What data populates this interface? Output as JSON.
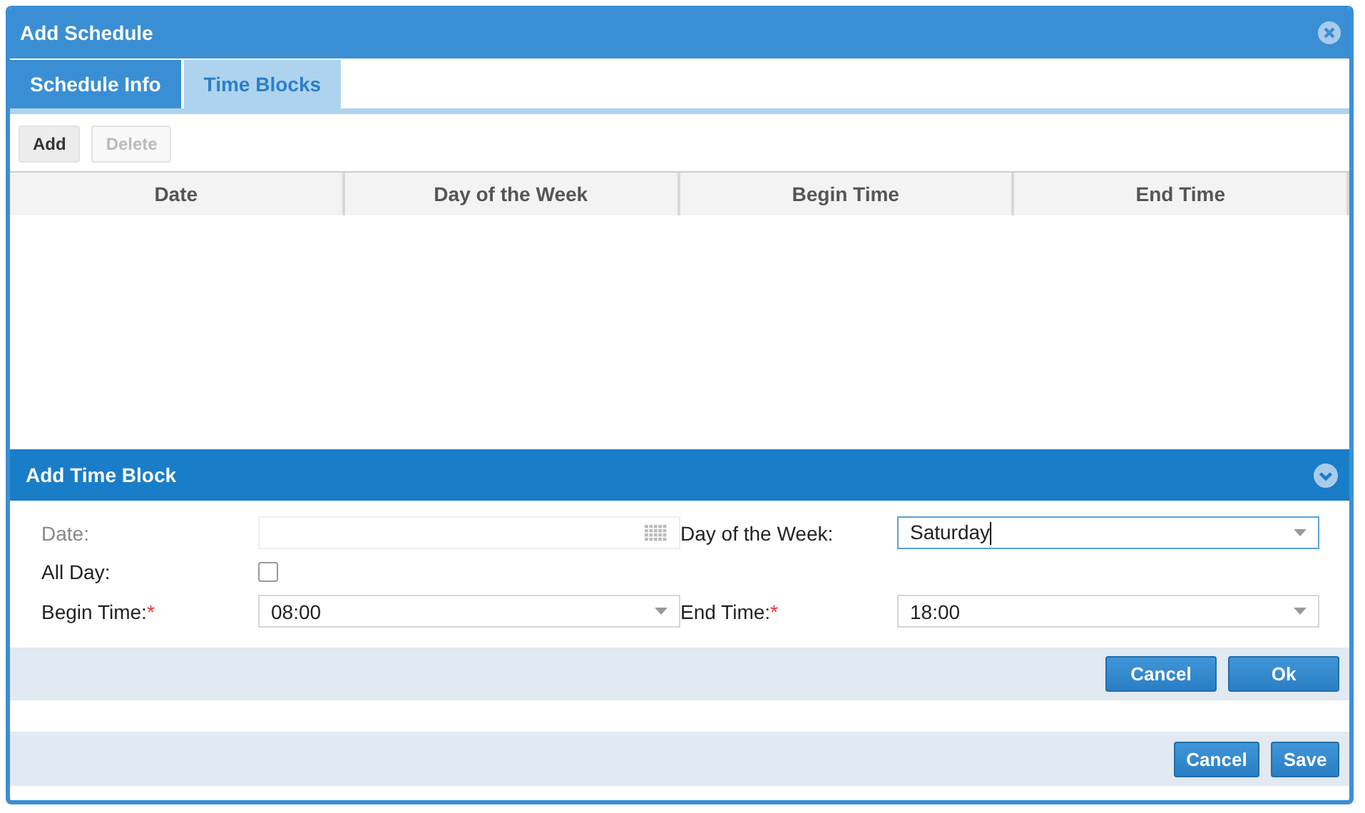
{
  "window": {
    "title": "Add Schedule"
  },
  "tabs": [
    {
      "label": "Schedule Info",
      "selected": false
    },
    {
      "label": "Time Blocks",
      "selected": true
    }
  ],
  "toolbar": [
    {
      "label": "Add",
      "disabled": false
    },
    {
      "label": "Delete",
      "disabled": true
    }
  ],
  "table": {
    "columns": [
      "Date",
      "Day of the Week",
      "Begin Time",
      "End Time"
    ]
  },
  "panel": {
    "title": "Add Time Block",
    "expanded": true,
    "fields": [
      {
        "kind": "date",
        "label": "Date:",
        "disabled": true
      },
      {
        "kind": "select",
        "label": "Day of the Week:",
        "value": "Saturday",
        "disabled": false,
        "focused": true
      },
      {
        "kind": "checkbox",
        "label": "All Day:",
        "disabled": false,
        "checked": false
      },
      {
        "kind": "spacer"
      },
      {
        "kind": "select",
        "label": "Begin Time:",
        "required_mark": "*",
        "value": "08:00",
        "disabled": false,
        "focused": false
      },
      {
        "kind": "select",
        "label": "End Time:",
        "required_mark": "*",
        "value": "18:00",
        "disabled": false,
        "focused": false
      }
    ],
    "buttons": [
      "Cancel",
      "Ok"
    ]
  },
  "footer_buttons": [
    "Cancel",
    "Save"
  ]
}
